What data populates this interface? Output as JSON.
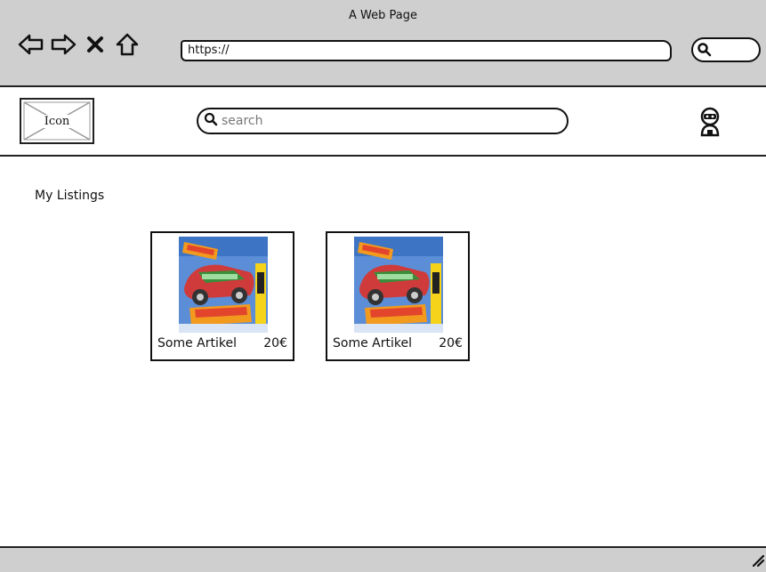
{
  "window": {
    "title": "A Web Page"
  },
  "browser": {
    "nav_icons": [
      "back-arrow-icon",
      "forward-arrow-icon",
      "close-x-icon",
      "home-icon"
    ],
    "address_value": "https://",
    "search_icon": "search-icon"
  },
  "header": {
    "logo_label": "Icon",
    "search_placeholder": "search",
    "user_icon": "user-avatar-icon"
  },
  "main": {
    "section_title": "My Listings",
    "listings": [
      {
        "name": "Some Artikel",
        "price": "20€",
        "image_icon": "toy-car-image"
      },
      {
        "name": "Some Artikel",
        "price": "20€",
        "image_icon": "toy-car-image"
      }
    ]
  },
  "colors": {
    "chrome_bg": "#cfcfcf",
    "border": "#222222",
    "thumb_blue": "#5b8ed6"
  }
}
